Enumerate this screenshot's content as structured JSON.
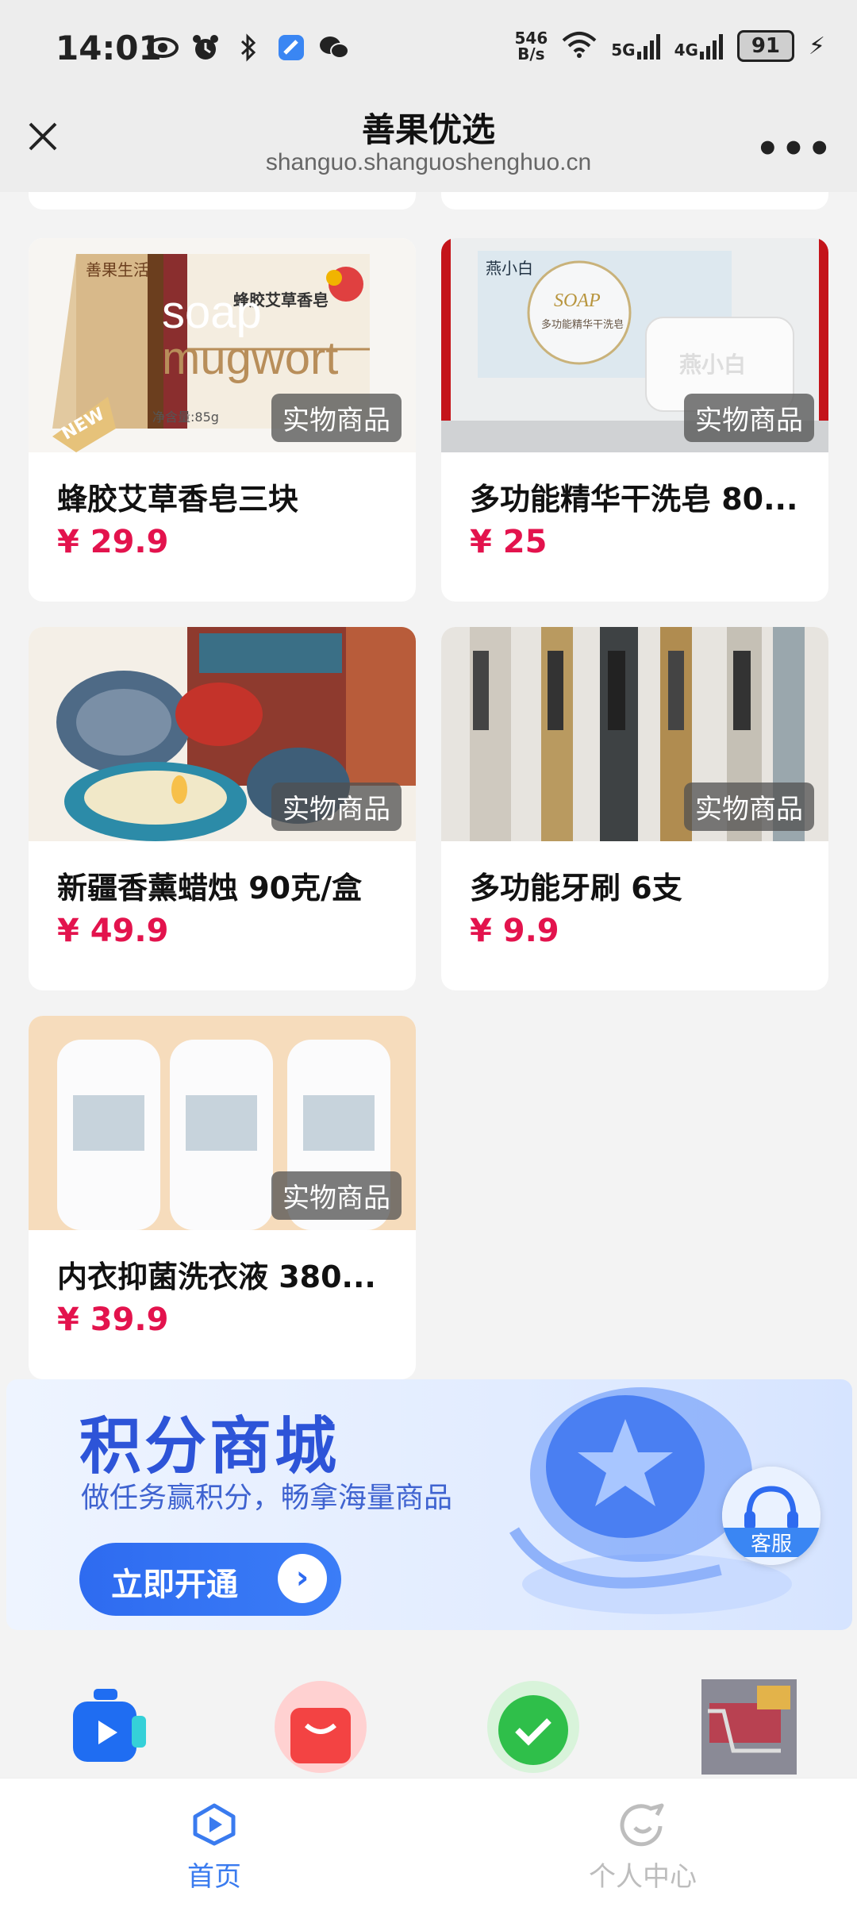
{
  "status_bar": {
    "time": "14:01",
    "net_speed_value": "546",
    "net_speed_unit": "B/s",
    "signal1": "5G",
    "signal2": "4G",
    "battery": "91"
  },
  "header": {
    "title": "善果优选",
    "subtitle": "shanguo.shanguoshenghuo.cn"
  },
  "products": [
    {
      "name": "蜂胶艾草香皂三块",
      "price": "¥ 29.9",
      "badge": "实物商品"
    },
    {
      "name": "多功能精华干洗皂 80...",
      "price": "¥ 25",
      "badge": "实物商品"
    },
    {
      "name": "新疆香薰蜡烛 90克/盒",
      "price": "¥ 49.9",
      "badge": "实物商品"
    },
    {
      "name": "多功能牙刷 6支",
      "price": "¥ 9.9",
      "badge": "实物商品"
    },
    {
      "name": "内衣抑菌洗衣液 380...",
      "price": "¥ 39.9",
      "badge": "实物商品"
    }
  ],
  "product_image_text": {
    "p1_brand": "善果生活",
    "p1_label": "蜂胶艾草香皂",
    "p1_soap": "soap",
    "p1_mug": "mugwort",
    "p1_new": "NEW",
    "p1_weight": "净含量:85g",
    "p2_brand": "燕小白",
    "p2_soap": "SOAP",
    "p2_title": "多功能精华干洗皂"
  },
  "banner": {
    "title": "积分商城",
    "subtitle": "做任务赢积分，畅拿海量商品",
    "button": "立即开通"
  },
  "service": {
    "label": "客服"
  },
  "tabbar": {
    "home": "首页",
    "profile": "个人中心"
  },
  "colors": {
    "price": "#e3134d",
    "accent": "#2e6bf0",
    "tab_active": "#3a7bef"
  }
}
